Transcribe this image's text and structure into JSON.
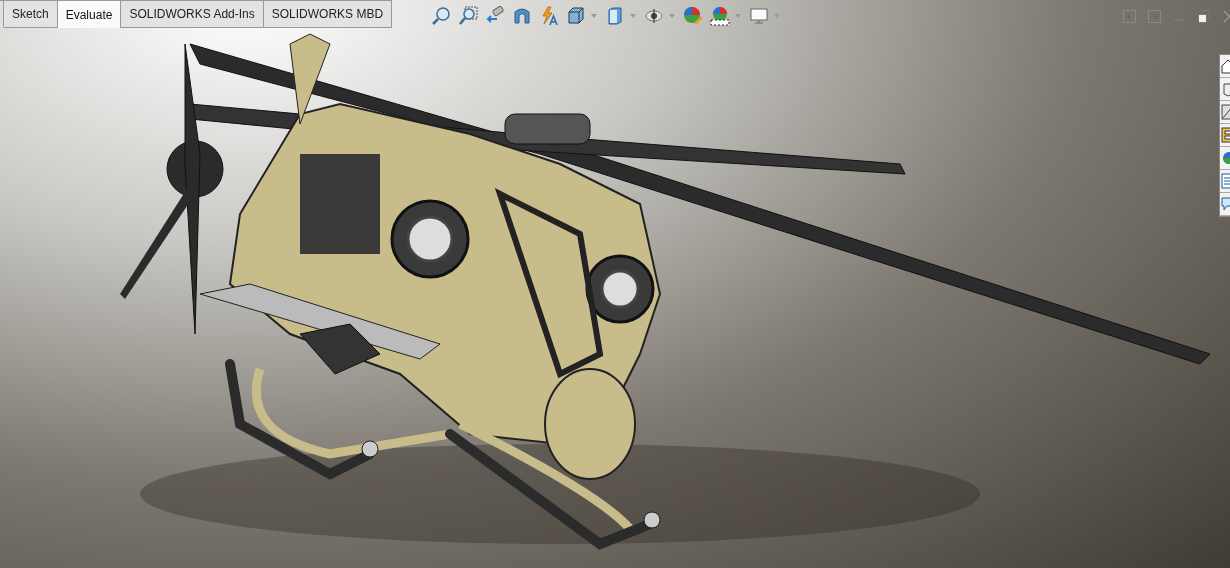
{
  "tabs": [
    {
      "label": "Sketch",
      "selected": false
    },
    {
      "label": "Evaluate",
      "selected": true
    },
    {
      "label": "SOLIDWORKS Add-Ins",
      "selected": false
    },
    {
      "label": "SOLIDWORKS MBD",
      "selected": false
    }
  ],
  "view_toolbar": [
    {
      "kind": "zoom-fit",
      "has_menu": false
    },
    {
      "kind": "zoom-area",
      "has_menu": false
    },
    {
      "kind": "previous-view",
      "has_menu": false
    },
    {
      "kind": "section",
      "has_menu": false
    },
    {
      "kind": "dynamic-annotation",
      "has_menu": false
    },
    {
      "kind": "view-orientation",
      "has_menu": true
    },
    {
      "kind": "display-style",
      "has_menu": true
    },
    {
      "kind": "hide-show",
      "has_menu": true
    },
    {
      "kind": "edit-appearance",
      "has_menu": false
    },
    {
      "kind": "scene",
      "has_menu": true
    },
    {
      "kind": "view-settings",
      "has_menu": true
    }
  ],
  "task_pane": [
    {
      "kind": "home"
    },
    {
      "kind": "parts"
    },
    {
      "kind": "library"
    },
    {
      "kind": "explorer"
    },
    {
      "kind": "appearances"
    },
    {
      "kind": "properties"
    },
    {
      "kind": "forum"
    }
  ]
}
